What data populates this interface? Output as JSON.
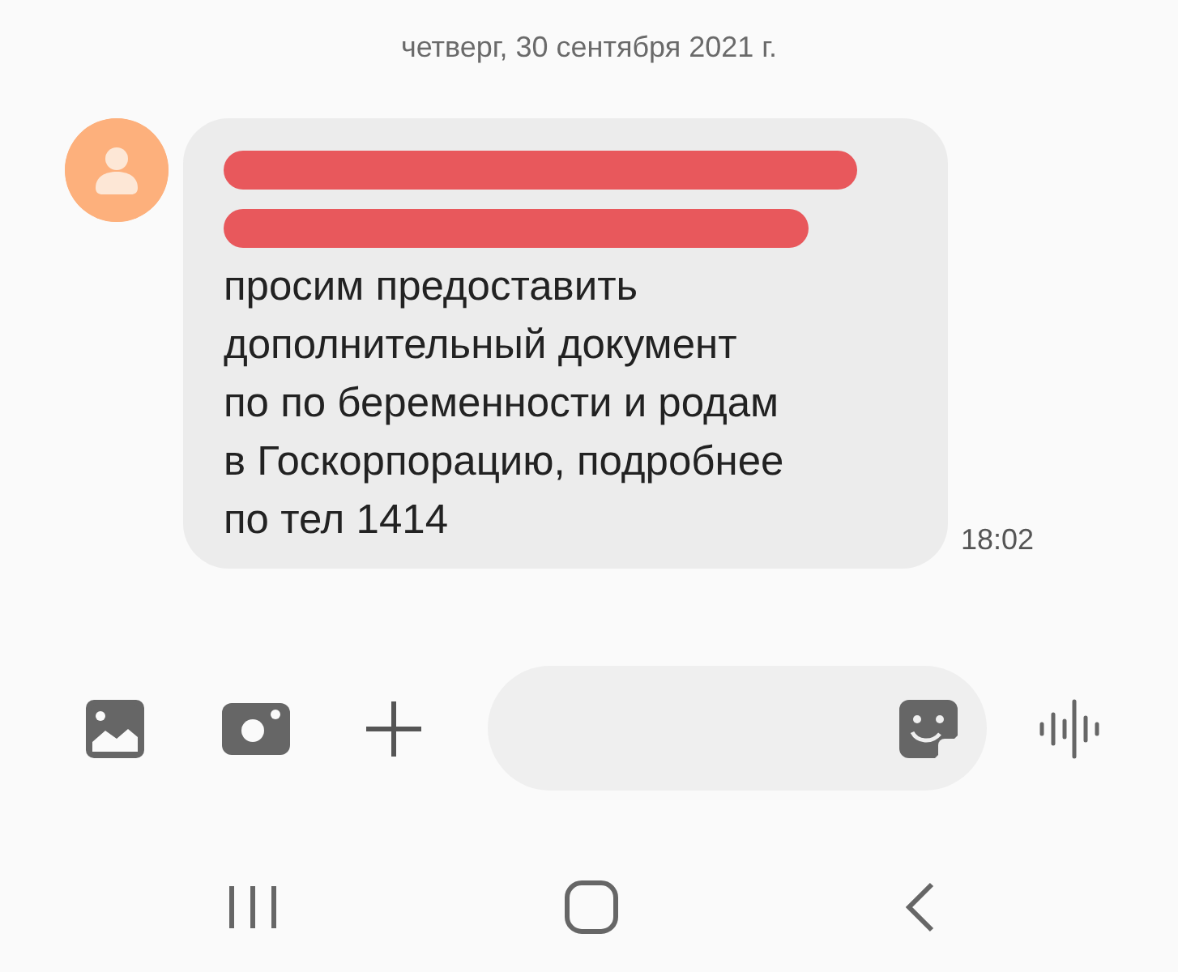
{
  "date_header": "четверг, 30 сентября 2021 г.",
  "message": {
    "lines": [
      {
        "kind": "redacted"
      },
      {
        "kind": "redacted"
      },
      {
        "kind": "text",
        "text": "просим предоставить"
      },
      {
        "kind": "text",
        "text": "дополнительный документ"
      },
      {
        "kind": "text",
        "text": "по по беременности и родам"
      },
      {
        "kind": "text",
        "text": "в Госкорпорацию, подробнее"
      },
      {
        "kind": "text",
        "text": "по тел 1414"
      }
    ],
    "time": "18:02"
  }
}
